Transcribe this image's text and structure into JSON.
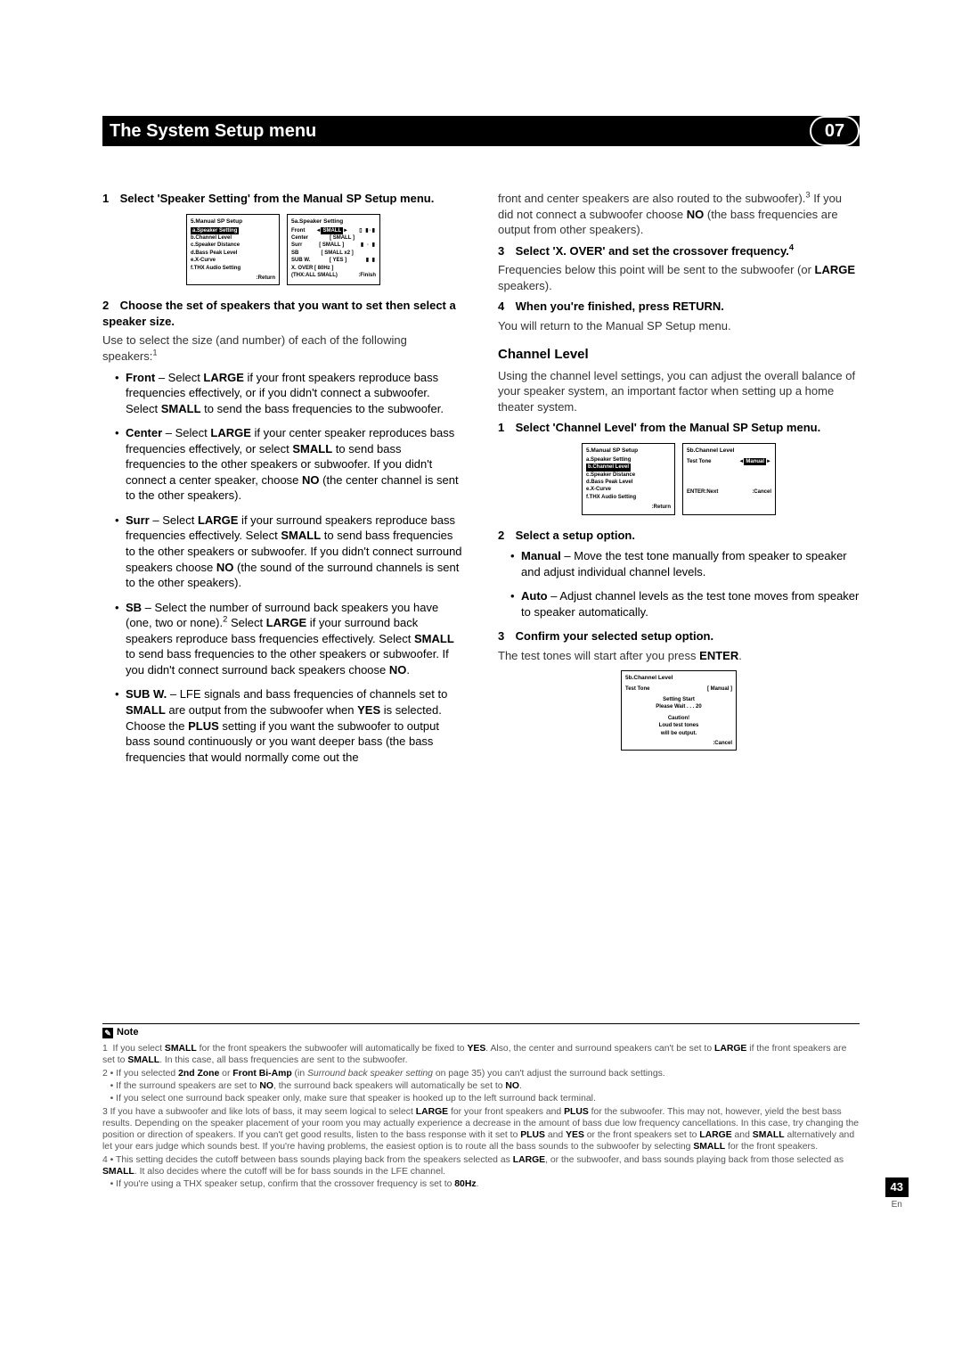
{
  "header": {
    "title": "The System Setup menu",
    "chapter": "07"
  },
  "left": {
    "s1": {
      "num": "1",
      "title": "Select 'Speaker Setting' from the Manual SP Setup menu."
    },
    "osd1": {
      "title": "5.Manual  SP  Setup",
      "a": "a.Speaker  Setting",
      "b": "b.Channel  Level",
      "c": "c.Speaker  Distance",
      "d": "d.Bass  Peak  Level",
      "e": "e.X-Curve",
      "f": "f.THX  Audio  Setting",
      "foot": ":Return"
    },
    "osd2": {
      "title": "5a.Speaker  Setting",
      "r1a": "Front",
      "r1b": "SMALL",
      "r2a": "Center",
      "r2b": "[  SMALL  ]",
      "r3a": "Surr",
      "r3b": "[  SMALL  ]",
      "r4a": "SB",
      "r4b": "[ SMALL x2 ]",
      "r5a": "SUB W.",
      "r5b": "[   YES   ]",
      "r6a": "X. OVER [   80Hz  ]",
      "thx": "(THX:ALL  SMALL)",
      "foot": ":Finish"
    },
    "s2": {
      "num": "2",
      "title": "Choose the set of speakers that you want to set then select a speaker size."
    },
    "s2_body_a": "Use ",
    "s2_body_b": " to select the size (and number) of each of the following speakers:",
    "s2_sup": "1",
    "bullets": {
      "front": "Front – Select LARGE if your front speakers reproduce bass frequencies effectively, or if you didn't connect a subwoofer. Select SMALL to send the bass frequencies to the subwoofer.",
      "center": "Center – Select LARGE if your center speaker reproduces bass frequencies effectively, or select SMALL to send bass frequencies to the other speakers or subwoofer. If you didn't connect a center speaker, choose NO (the center channel is sent to the other speakers).",
      "surr": "Surr – Select LARGE if your surround speakers reproduce bass frequencies effectively. Select SMALL to send bass frequencies to the other speakers or subwoofer. If you didn't connect surround speakers choose NO (the sound of the surround channels is sent to the other speakers).",
      "sb_a": "SB – Select the number of surround back speakers you have (one, two or none).",
      "sb_sup": "2",
      "sb_b": " Select LARGE if your surround back speakers reproduce bass frequencies effectively. Select SMALL to send bass frequencies to the other speakers or subwoofer. If you didn't connect surround back speakers choose NO.",
      "subw": "SUB W. – LFE signals and bass frequencies of channels set to SMALL are output from the subwoofer when YES is selected. Choose the PLUS setting if you want the subwoofer to output bass sound continuously or you want deeper bass (the bass frequencies that would normally come out the"
    }
  },
  "right": {
    "cont_a": "front and center speakers are also routed to the subwoofer).",
    "cont_sup": "3",
    "cont_b": " If you did not connect a subwoofer choose NO (the bass frequencies are output from other speakers).",
    "s3": {
      "num": "3",
      "title_a": "Select 'X. OVER' and set the crossover frequency.",
      "sup": "4"
    },
    "s3_body": "Frequencies below this point will be sent to the subwoofer (or LARGE speakers).",
    "s4": {
      "num": "4",
      "title": "When you're finished, press RETURN."
    },
    "s4_body": "You will return to the Manual SP Setup menu.",
    "chlevel_h": "Channel Level",
    "chlevel_intro": "Using the channel level settings, you can adjust the overall balance of your speaker system, an important factor when setting up a home theater system.",
    "cl_s1": {
      "num": "1",
      "title": "Select 'Channel Level' from the Manual SP Setup menu."
    },
    "osd3": {
      "title": "5.Manual  SP  Setup",
      "a": "a.Speaker  Setting",
      "b": "b.Channel  Level",
      "c": "c.Speaker  Distance",
      "d": "d.Bass  Peak  Level",
      "e": "e.X-Curve",
      "f": "f.THX  Audio  Setting",
      "foot": ":Return"
    },
    "osd4": {
      "title": "5b.Channel  Level",
      "r1a": "Test  Tone",
      "r1b": "Manual",
      "footL": "ENTER:Next",
      "footR": ":Cancel"
    },
    "cl_s2": {
      "num": "2",
      "title": "Select a setup option."
    },
    "cl_b1": "Manual – Move the test tone manually from speaker to speaker and adjust individual channel levels.",
    "cl_b2": "Auto – Adjust channel levels as the test tone moves from speaker to speaker automatically.",
    "cl_s3": {
      "num": "3",
      "title": "Confirm your selected setup option."
    },
    "cl_s3_body": "The test tones will start after you press ENTER.",
    "osd5": {
      "title": "5b.Channel  Level",
      "r1a": "Test  Tone",
      "r1b": "[ Manual ]",
      "l1": "Setting  Start",
      "l2": "Please  Wait . . .       20",
      "c1": "Caution!",
      "c2": "Loud  test  tones",
      "c3": "will  be  output.",
      "foot": ":Cancel"
    }
  },
  "notes": {
    "head": "Note",
    "n1": "1  If you select SMALL for the front speakers the subwoofer will automatically be fixed to YES. Also, the center and surround speakers can't be set to LARGE if the front speakers are set to SMALL. In this case, all bass frequencies are sent to the subwoofer.",
    "n2a": "2 • If you selected 2nd Zone or Front Bi-Amp (in Surround back speaker setting on page 35) you can't adjust the surround back settings.",
    "n2b": "• If the surround speakers are set to NO, the surround back speakers will automatically be set to NO.",
    "n2c": "• If you select one surround back speaker only, make sure that speaker is hooked up to the left surround back terminal.",
    "n3": "3 If you have a subwoofer and like lots of bass, it may seem logical to select LARGE for your front speakers and PLUS for the subwoofer. This may not, however, yield the best bass results. Depending on the speaker placement of your room you may actually experience a decrease in the amount of bass due low frequency cancellations. In this case, try changing the position or direction of speakers. If you can't get good results, listen to the bass response with it set to PLUS and YES or the front speakers set to LARGE and SMALL alternatively and let your ears judge which sounds best. If you're having problems, the easiest option is to route all the bass sounds to the subwoofer by selecting SMALL for the front speakers.",
    "n4a": "4 • This setting decides the cutoff between bass sounds playing back from the speakers selected as LARGE, or the subwoofer, and bass sounds playing back from those selected as SMALL. It also decides where the cutoff will be for bass sounds in the LFE channel.",
    "n4b": "• If you're using a THX speaker setup, confirm that the crossover frequency is set to 80Hz."
  },
  "page": {
    "num": "43",
    "lang": "En"
  }
}
